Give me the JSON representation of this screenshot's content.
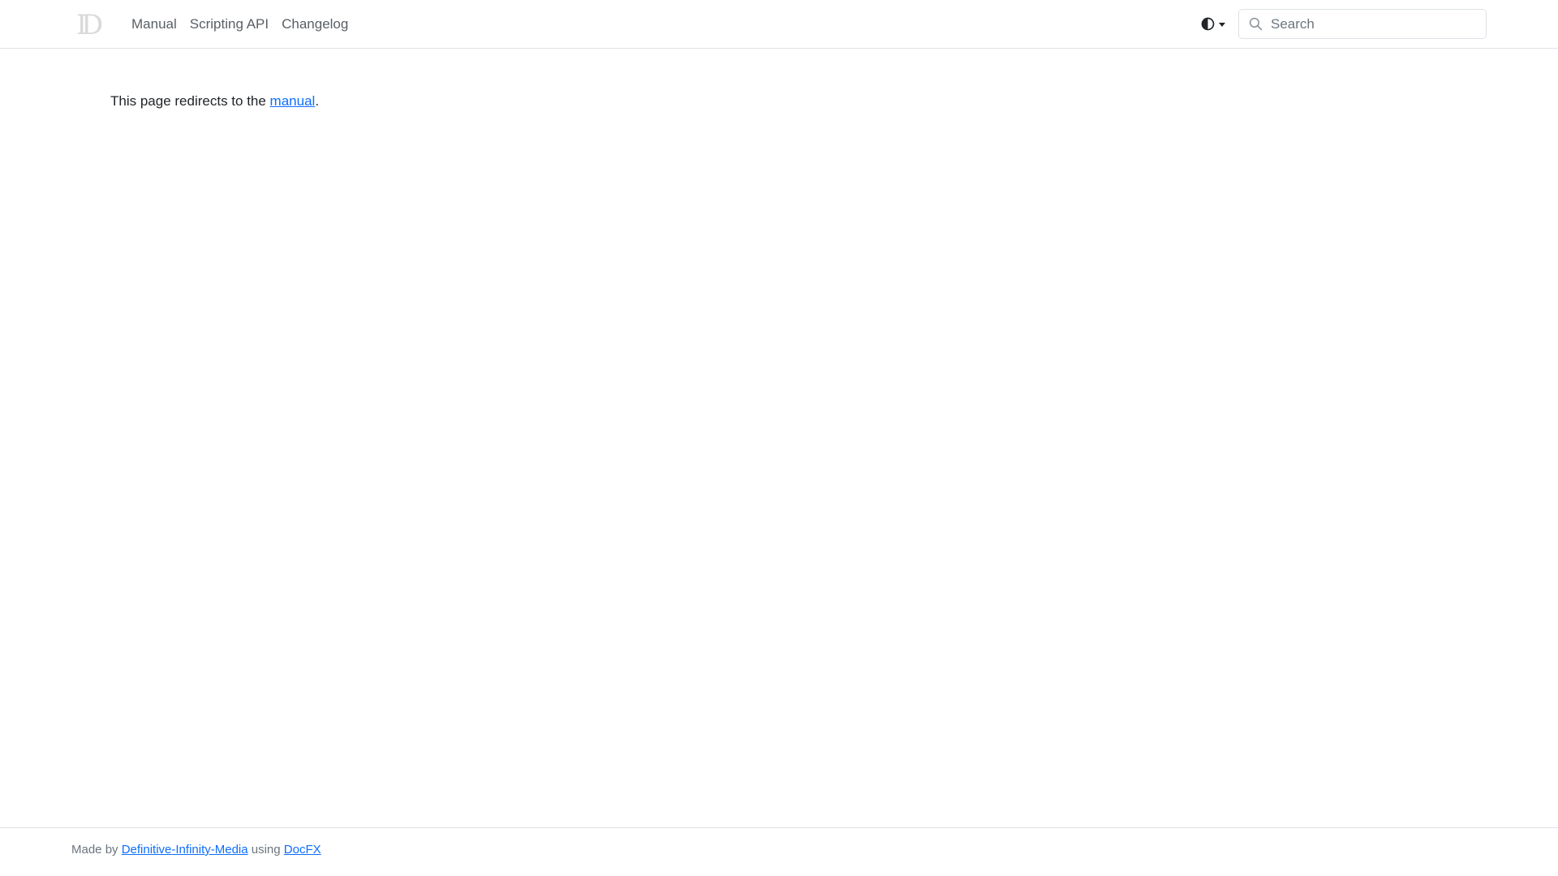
{
  "header": {
    "logo_icon": "d-logo-icon",
    "nav_items": [
      {
        "label": "Manual"
      },
      {
        "label": "Scripting API"
      },
      {
        "label": "Changelog"
      }
    ],
    "theme_toggle_icon": "half-circle-contrast-icon",
    "search": {
      "placeholder": "Search",
      "value": "",
      "icon": "search-icon"
    }
  },
  "main": {
    "text_before": "This page redirects to the ",
    "link_text": "manual",
    "text_after": "."
  },
  "footer": {
    "made_by_prefix": "Made by ",
    "author_link": "Definitive-Infinity-Media",
    "using_text": " using ",
    "tool_link": "DocFX"
  },
  "colors": {
    "link": "#0d6efd",
    "nav_text": "#5a5f64",
    "border": "#dee2e6",
    "footer_text": "#6c757d"
  }
}
